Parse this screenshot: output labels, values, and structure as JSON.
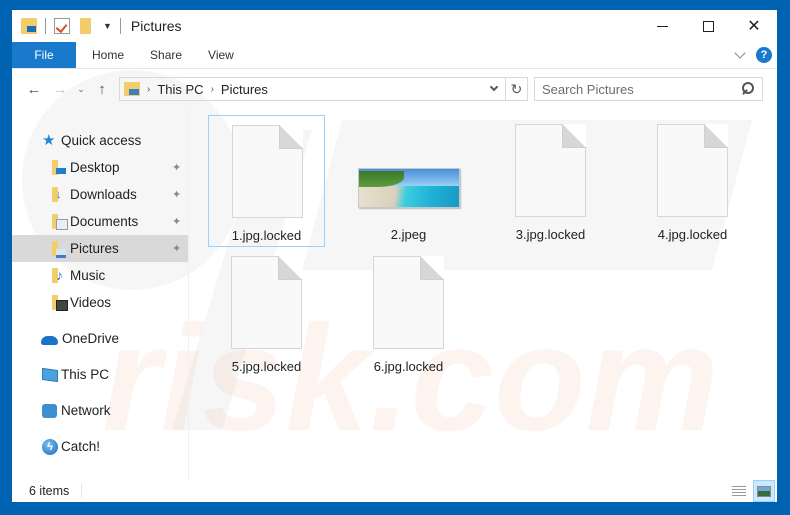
{
  "window": {
    "title": "Pictures",
    "controls": {
      "minimize": "minimize",
      "maximize": "maximize",
      "close": "✕"
    }
  },
  "quick_access_toolbar": {
    "icons": [
      "folder-properties-icon",
      "properties-check-icon",
      "new-folder-icon"
    ],
    "dropdown_glyph": "▼"
  },
  "ribbon": {
    "tabs": [
      {
        "label": "File",
        "active": true
      },
      {
        "label": "Home"
      },
      {
        "label": "Share"
      },
      {
        "label": "View"
      }
    ],
    "help_label": "?"
  },
  "navigation": {
    "back_glyph": "←",
    "forward_glyph": "→",
    "recent_glyph": "⌄",
    "up_glyph": "↑",
    "breadcrumb": [
      "This PC",
      "Pictures"
    ],
    "breadcrumb_sep": "›",
    "refresh_glyph": "↻",
    "search_placeholder": "Search Pictures"
  },
  "sidebar": {
    "pin_glyph": "📌",
    "items": [
      {
        "label": "Quick access",
        "icon": "star-icon"
      },
      {
        "label": "Desktop",
        "icon": "desktop-folder-icon",
        "pinned": true
      },
      {
        "label": "Downloads",
        "icon": "downloads-folder-icon",
        "pinned": true
      },
      {
        "label": "Documents",
        "icon": "documents-folder-icon",
        "pinned": true
      },
      {
        "label": "Pictures",
        "icon": "pictures-folder-icon",
        "pinned": true,
        "selected": true
      },
      {
        "label": "Music",
        "icon": "music-folder-icon"
      },
      {
        "label": "Videos",
        "icon": "videos-folder-icon"
      },
      {
        "label": "OneDrive",
        "icon": "onedrive-icon"
      },
      {
        "label": "This PC",
        "icon": "this-pc-icon"
      },
      {
        "label": "Network",
        "icon": "network-icon"
      },
      {
        "label": "Catch!",
        "icon": "catch-icon"
      }
    ]
  },
  "files": [
    {
      "name": "1.jpg.locked",
      "type": "locked",
      "focused": true
    },
    {
      "name": "2.jpeg",
      "type": "image"
    },
    {
      "name": "3.jpg.locked",
      "type": "locked"
    },
    {
      "name": "4.jpg.locked",
      "type": "locked"
    },
    {
      "name": "5.jpg.locked",
      "type": "locked"
    },
    {
      "name": "6.jpg.locked",
      "type": "locked"
    }
  ],
  "status": {
    "item_count": "6 items",
    "view_modes": [
      {
        "name": "details-view",
        "active": false
      },
      {
        "name": "large-icons-view",
        "active": true
      }
    ]
  },
  "colors": {
    "accent": "#1979ca",
    "frame": "#0063b1",
    "selection": "#d9d9d9",
    "focus_border": "#99d1ff"
  }
}
